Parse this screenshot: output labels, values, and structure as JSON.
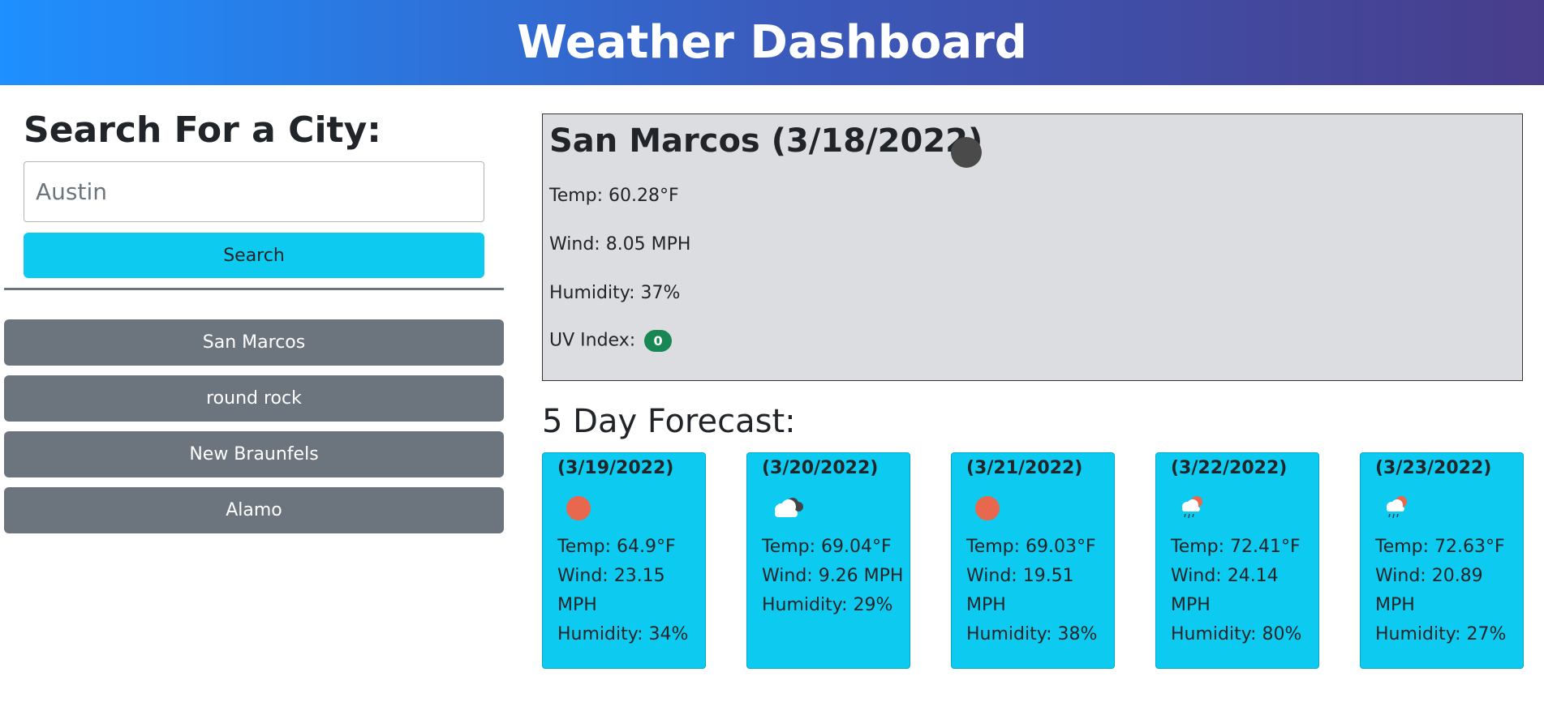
{
  "header": {
    "title": "Weather Dashboard"
  },
  "search": {
    "heading": "Search For a City:",
    "placeholder": "Austin",
    "button_label": "Search"
  },
  "history": [
    {
      "label": "San Marcos"
    },
    {
      "label": "round rock"
    },
    {
      "label": "New Braunfels"
    },
    {
      "label": "Alamo"
    }
  ],
  "current": {
    "title": "San Marcos (3/18/2022)",
    "icon": "moon-icon",
    "temp": "Temp: 60.28°F",
    "wind": "Wind: 8.05 MPH",
    "humidity": "Humidity: 37%",
    "uv_label": "UV Index:",
    "uv_value": "0",
    "uv_color": "#198754"
  },
  "forecast": {
    "heading": "5 Day Forecast:",
    "days": [
      {
        "date": "(3/19/2022)",
        "icon": "sun-icon",
        "temp": "Temp: 64.9°F",
        "wind": "Wind: 23.15 MPH",
        "humidity": "Humidity: 34%"
      },
      {
        "date": "(3/20/2022)",
        "icon": "cloudy-icon",
        "temp": "Temp: 69.04°F",
        "wind": "Wind: 9.26 MPH",
        "humidity": "Humidity: 29%"
      },
      {
        "date": "(3/21/2022)",
        "icon": "sun-icon",
        "temp": "Temp: 69.03°F",
        "wind": "Wind: 19.51 MPH",
        "humidity": "Humidity: 38%"
      },
      {
        "date": "(3/22/2022)",
        "icon": "rain-sun-icon",
        "temp": "Temp: 72.41°F",
        "wind": "Wind: 24.14 MPH",
        "humidity": "Humidity: 80%"
      },
      {
        "date": "(3/23/2022)",
        "icon": "rain-sun-icon",
        "temp": "Temp: 72.63°F",
        "wind": "Wind: 20.89 MPH",
        "humidity": "Humidity: 27%"
      }
    ]
  },
  "colors": {
    "accent": "#0dcaf0",
    "history_button": "#6c757d",
    "current_bg": "#dcdde0",
    "sun": "#e8674f"
  }
}
